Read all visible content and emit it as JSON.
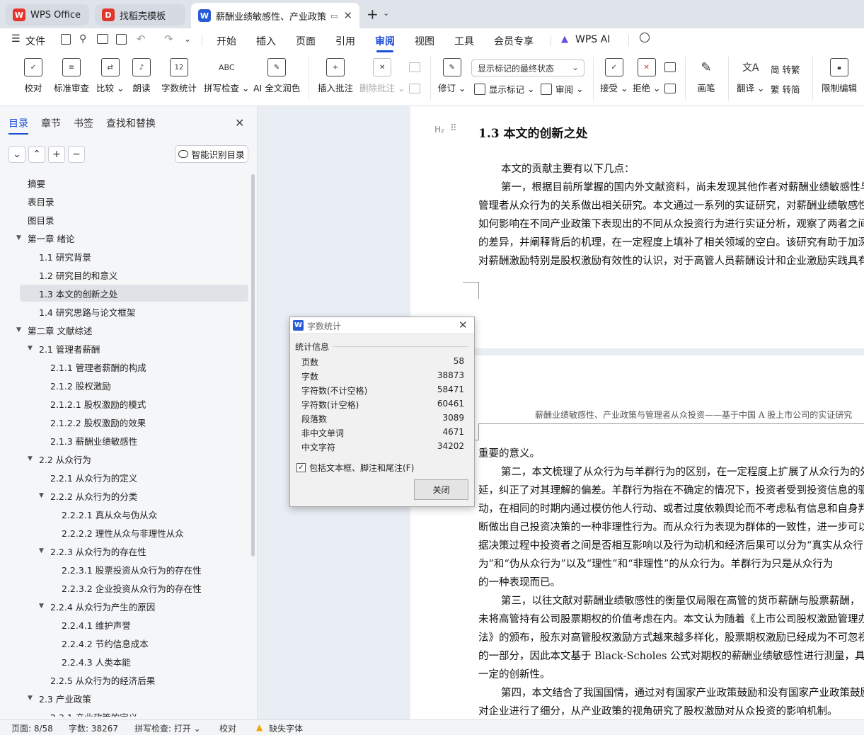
{
  "tabs": [
    {
      "label": "WPS Office",
      "icon": "wps-logo-icon",
      "color": "#e8352b"
    },
    {
      "label": "找稻壳模板",
      "icon": "docer-icon",
      "color": "#e0362c"
    },
    {
      "label": "薪酬业绩敏感性、产业政策与管",
      "icon": "writer-doc-icon",
      "color": "#2a5bd7"
    }
  ],
  "menu": {
    "file": "文件",
    "items": [
      "开始",
      "插入",
      "页面",
      "引用",
      "审阅",
      "视图",
      "工具",
      "会员专享"
    ],
    "active": "审阅",
    "ai": "WPS AI"
  },
  "ribbon": {
    "proofread": "校对",
    "standard_review": "标准审查",
    "compare": "比较",
    "read_aloud": "朗读",
    "word_count": "字数统计",
    "spell_check": "拼写检查",
    "ai_proofread": "AI 全文润色",
    "insert_comment": "插入批注",
    "delete_comment": "删除批注",
    "revise": "修订",
    "display_mode": "显示标记的最终状态",
    "show_marks": "显示标记",
    "review": "审阅",
    "accept": "接受",
    "reject": "拒绝",
    "ink": "画笔",
    "translate": "翻译",
    "to_traditional": "简 转繁",
    "to_simplified": "繁 转简",
    "restrict_edit": "限制编辑"
  },
  "sidebar": {
    "tabs": [
      "目录",
      "章节",
      "书签",
      "查找和替换"
    ],
    "smart_toc": "智能识别目录",
    "toc": [
      {
        "label": "摘要",
        "level": 1,
        "arrow": false
      },
      {
        "label": "表目录",
        "level": 1,
        "arrow": false
      },
      {
        "label": "图目录",
        "level": 1,
        "arrow": false
      },
      {
        "label": "第一章  绪论",
        "level": 1,
        "arrow": true
      },
      {
        "label": "1.1  研究背景",
        "level": 2,
        "arrow": false
      },
      {
        "label": "1.2  研究目的和意义",
        "level": 2,
        "arrow": false
      },
      {
        "label": "1.3  本文的创新之处",
        "level": 2,
        "arrow": false,
        "selected": true
      },
      {
        "label": "1.4  研究思路与论文框架",
        "level": 2,
        "arrow": false
      },
      {
        "label": "第二章  文献综述",
        "level": 1,
        "arrow": true
      },
      {
        "label": "2.1  管理者薪酬",
        "level": 2,
        "arrow": true
      },
      {
        "label": "2.1.1  管理者薪酬的构成",
        "level": 3,
        "arrow": false
      },
      {
        "label": "2.1.2  股权激励",
        "level": 3,
        "arrow": false
      },
      {
        "label": "2.1.2.1  股权激励的模式",
        "level": 3,
        "arrow": false
      },
      {
        "label": "2.1.2.2  股权激励的效果",
        "level": 3,
        "arrow": false
      },
      {
        "label": "2.1.3  薪酬业绩敏感性",
        "level": 3,
        "arrow": false
      },
      {
        "label": "2.2  从众行为",
        "level": 2,
        "arrow": true
      },
      {
        "label": "2.2.1  从众行为的定义",
        "level": 3,
        "arrow": false
      },
      {
        "label": "2.2.2  从众行为的分类",
        "level": 3,
        "arrow": true
      },
      {
        "label": "2.2.2.1  真从众与伪从众",
        "level": 4,
        "arrow": false
      },
      {
        "label": "2.2.2.2  理性从众与非理性从众",
        "level": 4,
        "arrow": false
      },
      {
        "label": "2.2.3  从众行为的存在性",
        "level": 3,
        "arrow": true
      },
      {
        "label": "2.2.3.1  股票投资从众行为的存在性",
        "level": 4,
        "arrow": false
      },
      {
        "label": "2.2.3.2  企业投资从众行为的存在性",
        "level": 4,
        "arrow": false
      },
      {
        "label": "2.2.4 从众行为产生的原因",
        "level": 3,
        "arrow": true
      },
      {
        "label": "2.2.4.1  维护声誉",
        "level": 4,
        "arrow": false
      },
      {
        "label": "2.2.4.2  节约信息成本",
        "level": 4,
        "arrow": false
      },
      {
        "label": "2.2.4.3  人类本能",
        "level": 4,
        "arrow": false
      },
      {
        "label": "2.2.5  从众行为的经济后果",
        "level": 3,
        "arrow": false
      },
      {
        "label": "2.3  产业政策",
        "level": 2,
        "arrow": true
      },
      {
        "label": "2.3.1  产业政策的定义",
        "level": 3,
        "arrow": false
      }
    ]
  },
  "document": {
    "heading_marker": "H₂",
    "heading": "1.3  本文的创新之处",
    "page1": [
      "本文的贡献主要有以下几点：",
      "第一，根据目前所掌握的国内外文献资料，尚未发现其他作者对薪酬业绩敏感性与",
      "管理者从众行为的关系做出相关研究。本文通过一系列的实证研究，对薪酬业绩敏感性",
      "如何影响在不同产业政策下表现出的不同从众投资行为进行实证分析，观察了两者之间",
      "的差异，并阐释背后的机理，在一定程度上填补了相关领域的空白。该研究有助于加深",
      "对薪酬激励特别是股权激励有效性的认识，对于高管人员薪酬设计和企业激励实践具有"
    ],
    "running_header": "薪酬业绩敏感性、产业政策与管理者从众投资——基于中国 A 股上市公司的实证研究",
    "page2": [
      "重要的意义。",
      "第二，本文梳理了从众行为与羊群行为的区别，在一定程度上扩展了从众行为的外",
      "延，纠正了对其理解的偏差。羊群行为指在不确定的情况下，投资者受到投资信息的驱",
      "动，在相同的时期内通过模仿他人行动、或者过度依赖舆论而不考虑私有信息和自身判",
      "断做出自己投资决策的一种非理性行为。而从众行为表现为群体的一致性，进一步可以根",
      "据决策过程中投资者之间是否相互影响以及行为动机和经济后果可以分为“真实从众行",
      "为”和“伪从众行为”以及“理性”和“非理性”的从众行为。羊群行为只是从众行为",
      "的一种表现而已。",
      "第三，以往文献对薪酬业绩敏感性的衡量仅局限在高管的货币薪酬与股票薪酬，",
      "未将高管持有公司股票期权的价值考虑在内。本文认为随着《上市公司股权激励管理办",
      "法》的颁布，股东对高管股权激励方式越来越多样化，股票期权激励已经成为不可忽视",
      "的一部分，因此本文基于 Black-Scholes 公式对期权的薪酬业绩敏感性进行测量，具有",
      "一定的创新性。",
      "第四，本文结合了我国国情，通过对有国家产业政策鼓励和没有国家产业政策鼓励的",
      "对企业进行了细分，从产业政策的视角研究了股权激励对从众投资的影响机制。"
    ]
  },
  "dialog": {
    "title": "字数统计",
    "section": "统计信息",
    "rows": [
      {
        "label": "页数",
        "value": "58"
      },
      {
        "label": "字数",
        "value": "38873"
      },
      {
        "label": "字符数(不计空格)",
        "value": "58471"
      },
      {
        "label": "字符数(计空格)",
        "value": "60461"
      },
      {
        "label": "段落数",
        "value": "3089"
      },
      {
        "label": "非中文单词",
        "value": "4671"
      },
      {
        "label": "中文字符",
        "value": "34202"
      }
    ],
    "checkbox_label": "包括文本框、脚注和尾注(F)",
    "checkbox_checked": true,
    "close_label": "关闭"
  },
  "status": {
    "page": "页面: 8/58",
    "words": "字数: 38267",
    "spell": "拼写检查: 打开",
    "proof": "校对",
    "missing_font": "缺失字体"
  },
  "colors": {
    "accent": "#1d4ed8",
    "warning": "#f0a500"
  }
}
